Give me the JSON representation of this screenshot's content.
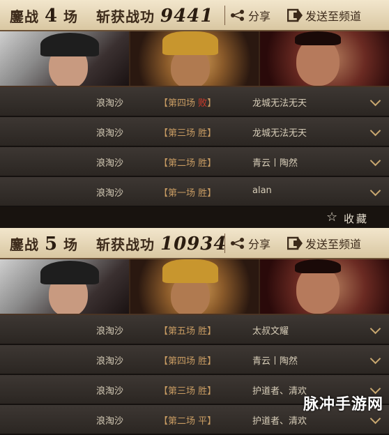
{
  "battles": [
    {
      "label": "鏖战",
      "count": "4",
      "unit": "场",
      "score_label": "斩获战功",
      "score": "9441",
      "share": "分享",
      "send": "发送至频道",
      "rows": [
        {
          "team": "浪淘沙",
          "round": "【第四场",
          "result": "败",
          "close": "】",
          "opponent": "龙城无法无天",
          "result_type": "lose"
        },
        {
          "team": "浪淘沙",
          "round": "【第三场",
          "result": "胜",
          "close": "】",
          "opponent": "龙城无法无天",
          "result_type": "win"
        },
        {
          "team": "浪淘沙",
          "round": "【第二场",
          "result": "胜",
          "close": "】",
          "opponent": "青云丨陶然",
          "result_type": "win"
        },
        {
          "team": "浪淘沙",
          "round": "【第一场",
          "result": "胜",
          "close": "】",
          "opponent": "alan",
          "result_type": "win"
        }
      ]
    },
    {
      "label": "鏖战",
      "count": "5",
      "unit": "场",
      "score_label": "斩获战功",
      "score": "10934",
      "share": "分享",
      "send": "发送至频道",
      "rows": [
        {
          "team": "浪淘沙",
          "round": "【第五场",
          "result": "胜",
          "close": "】",
          "opponent": "太叔文耀",
          "result_type": "win"
        },
        {
          "team": "浪淘沙",
          "round": "【第四场",
          "result": "胜",
          "close": "】",
          "opponent": "青云丨陶然",
          "result_type": "win"
        },
        {
          "team": "浪淘沙",
          "round": "【第三场",
          "result": "胜",
          "close": "】",
          "opponent": "护道者、清欢",
          "result_type": "win"
        },
        {
          "team": "浪淘沙",
          "round": "【第二场",
          "result": "平",
          "close": "】",
          "opponent": "护道者、清欢",
          "result_type": "win"
        }
      ]
    }
  ],
  "favorite": {
    "label": "收藏",
    "icon": "star-icon"
  },
  "watermark": "脉冲手游网",
  "colors": {
    "header_bg": "#e4d4b3",
    "row_bg": "#35302c",
    "lose": "#d23a2a",
    "win": "#c79b62"
  }
}
